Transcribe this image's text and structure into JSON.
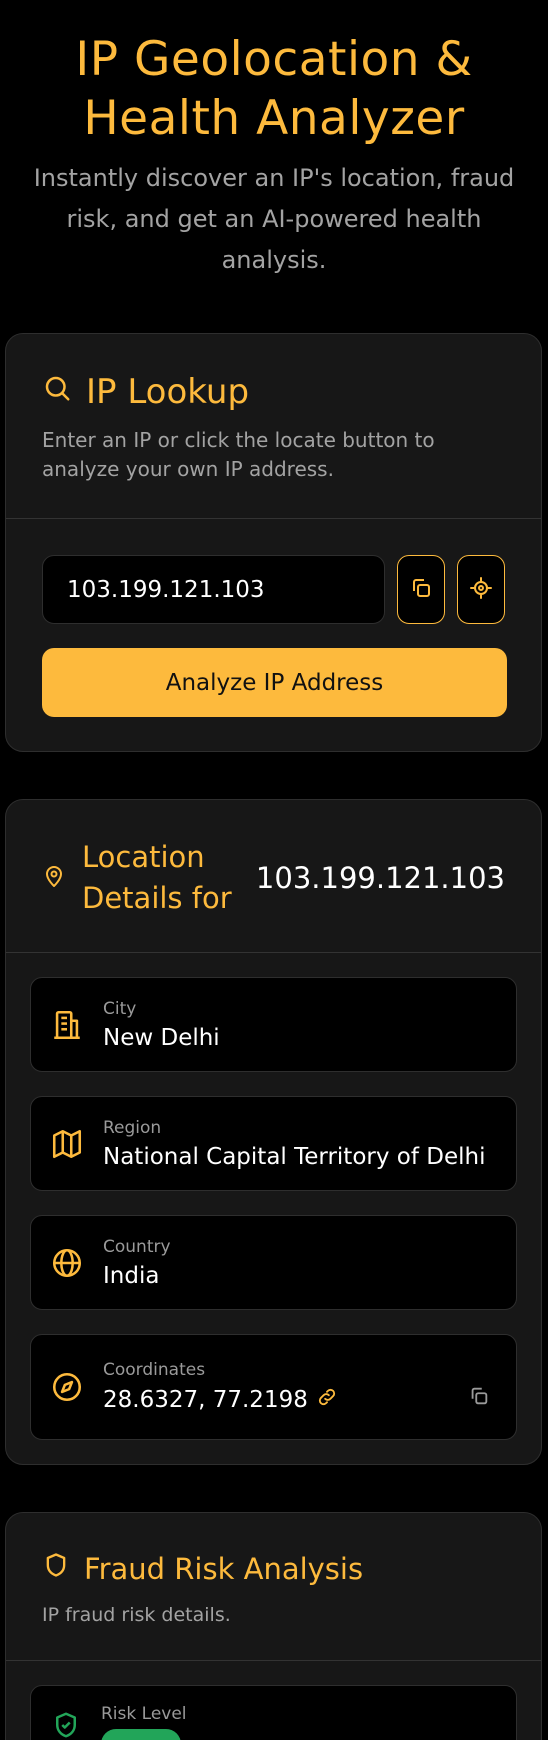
{
  "header": {
    "title_line1": "IP Geolocation &",
    "title_line2": "Health Analyzer",
    "subtitle": "Instantly discover an IP's location, fraud risk, and get an AI-powered health analysis."
  },
  "lookup": {
    "title": "IP Lookup",
    "description": "Enter an IP or click the locate button to analyze your own IP address.",
    "ip_value": "103.199.121.103",
    "analyze_label": "Analyze IP Address"
  },
  "location": {
    "title": "Location Details for",
    "ip": "103.199.121.103",
    "city_label": "City",
    "city_value": "New Delhi",
    "region_label": "Region",
    "region_value": "National Capital Territory of Delhi",
    "country_label": "Country",
    "country_value": "India",
    "coords_label": "Coordinates",
    "coords_value": "28.6327, 77.2198"
  },
  "fraud": {
    "title": "Fraud Risk Analysis",
    "description": "IP fraud risk details.",
    "risk_label": "Risk Level"
  },
  "colors": {
    "accent": "#FDBA3D",
    "background": "#000000",
    "card": "#171717",
    "risk_low": "#22a559"
  }
}
